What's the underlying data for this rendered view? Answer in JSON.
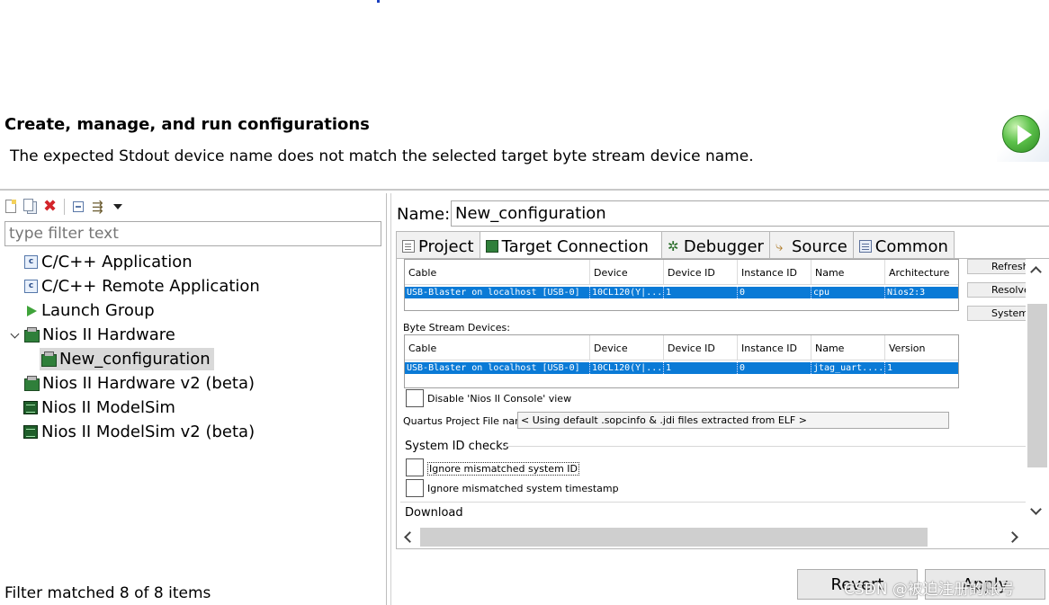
{
  "header": {
    "title": "Create, manage, and run configurations",
    "message": "The expected Stdout device name does not match the selected target byte stream device name."
  },
  "left": {
    "filter_placeholder": "type filter text",
    "tree": [
      {
        "label": "C/C++ Application"
      },
      {
        "label": "C/C++ Remote Application"
      },
      {
        "label": "Launch Group"
      },
      {
        "label": "Nios II Hardware"
      },
      {
        "label": "New_configuration"
      },
      {
        "label": "Nios II Hardware v2 (beta)"
      },
      {
        "label": "Nios II ModelSim"
      },
      {
        "label": "Nios II ModelSim v2 (beta)"
      }
    ],
    "status": "Filter matched 8 of 8 items"
  },
  "right": {
    "name_label": "Name:",
    "name_value": "New_configuration",
    "tabs": [
      "Project",
      "Target Connection",
      "Debugger",
      "Source",
      "Common"
    ],
    "processors": {
      "headers": [
        "Cable",
        "Device",
        "Device ID",
        "Instance ID",
        "Name",
        "Architecture"
      ],
      "row": [
        "USB-Blaster on localhost [USB-0]",
        "10CL120(Y|...",
        "1",
        "0",
        "cpu",
        "Nios2:3"
      ]
    },
    "byte_stream_label": "Byte Stream Devices:",
    "byte_stream": {
      "headers": [
        "Cable",
        "Device",
        "Device ID",
        "Instance ID",
        "Name",
        "Version"
      ],
      "row": [
        "USB-Blaster on localhost [USB-0]",
        "10CL120(Y|...",
        "1",
        "0",
        "jtag_uart....",
        "1"
      ]
    },
    "disable_console": "Disable 'Nios II Console' view",
    "quartus_label": "Quartus Project File name:",
    "quartus_value": "< Using default .sopcinfo & .jdi files extracted from ELF >",
    "sysid_group": "System ID checks",
    "ignore_id": "Ignore mismatched system ID",
    "ignore_ts": "Ignore mismatched system timestamp",
    "download_group": "Download",
    "side_buttons": [
      "Refresh",
      "Resolve",
      "System"
    ],
    "revert": "Revert",
    "apply": "Apply"
  },
  "watermark": "CSDN @被迫注册的账号"
}
